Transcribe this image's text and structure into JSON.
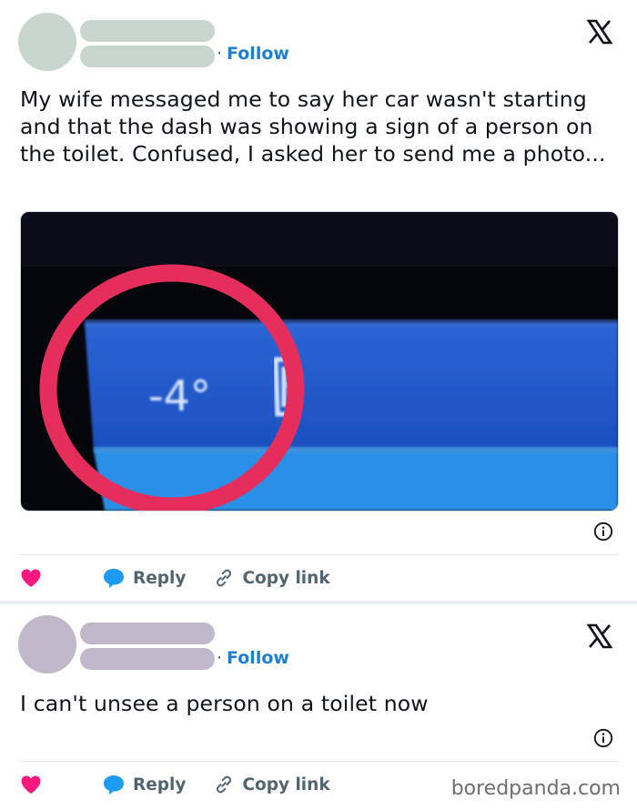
{
  "posts": [
    {
      "follow_label": "Follow",
      "follow_separator": "·",
      "text": "My wife messaged me to say her car wasn't starting and that the dash was showing a sign of a person on the toilet. Confused, I asked her to send me a photo...",
      "media": {
        "readout_text": "-4°",
        "icon_name": "door-ajar-icon"
      },
      "colors": {
        "avatar": "#c9d6cd",
        "name_bar": "#c9d6cd"
      },
      "actions": {
        "reply_label": "Reply",
        "copy_label": "Copy link"
      }
    },
    {
      "follow_label": "Follow",
      "follow_separator": "·",
      "text": "I can't unsee a person on a toilet now",
      "colors": {
        "avatar": "#c2b8cb",
        "name_bar": "#c2b8cb"
      },
      "actions": {
        "reply_label": "Reply",
        "copy_label": "Copy link"
      }
    }
  ],
  "watermark": "boredpanda.com",
  "colors": {
    "follow": "#1d7fd0",
    "heart": "#f91880",
    "reply_bubble": "#1d9bf0",
    "dash_blue": "#1f5fd0",
    "circle": "#e62e5c"
  }
}
